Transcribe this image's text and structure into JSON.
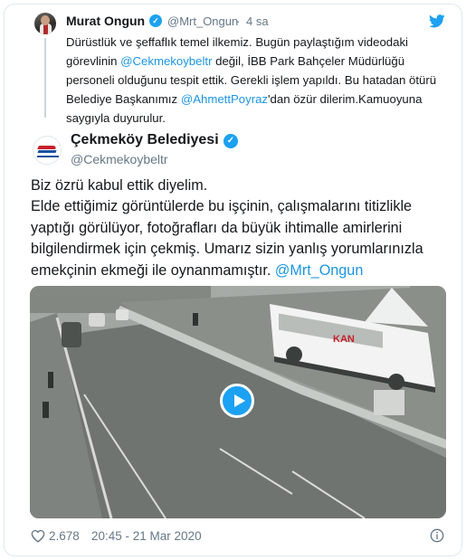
{
  "parent_tweet": {
    "name": "Murat Ongun",
    "handle": "@Mrt_Ongun",
    "separator": "·",
    "time": "4 sa",
    "text_part1": "Dürüstlük ve şeffaflık temel ilkemiz. Bugün paylaştığım videodaki görevlinin ",
    "mention1": "@Cekmekoybeltr",
    "text_part2": " değil, İBB Park Bahçeler Müdürlüğü personeli olduğunu tespit ettik. Gerekli işlem yapıldı. Bu hatadan ötürü Belediye Başkanımız ",
    "mention2": "@AhmettPoyraz",
    "text_part3": "'dan özür dilerim.Kamuoyuna saygıyla duyurulur."
  },
  "main_tweet": {
    "name": "Çekmeköy Belediyesi",
    "handle": "@Cekmekoybeltr",
    "text_line1": "Biz özrü kabul ettik diyelim.",
    "text_body": "Elde ettiğimiz görüntülerde bu işçinin, çalışmalarını titizlikle yaptığı görülüyor, fotoğrafları da büyük ihtimalle amirlerini bilgilendirmek için çekmiş. Umarız sizin yanlış yorumlarınızla emekçinin ekmeği ile oynanmamıştır. ",
    "mention": "@Mrt_Ongun",
    "video_bus_text": "KAN",
    "likes": "2.678",
    "timestamp": "20:45 - 21 Mar 2020"
  },
  "colors": {
    "accent": "#1da1f2",
    "link": "#1b95e0",
    "muted": "#657786"
  },
  "icons": [
    "verified-badge-icon",
    "twitter-bird-icon",
    "play-icon",
    "heart-icon",
    "info-icon"
  ]
}
